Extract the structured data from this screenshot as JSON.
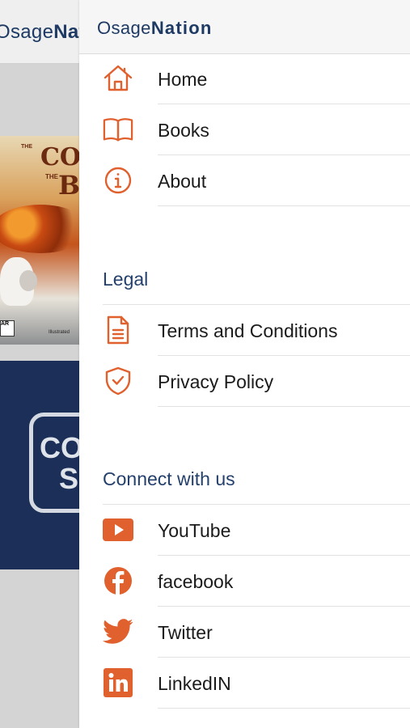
{
  "background": {
    "logo_light": "Osage",
    "logo_bold": "Nation",
    "cover_word_1": "THE",
    "cover_title_1": "CO",
    "cover_word_2": "THE",
    "cover_title_2": "B",
    "cover_badge": "AR",
    "cover_credit": "Illustrated",
    "banner_line_1": "CO",
    "banner_line_2": "S"
  },
  "drawer": {
    "logo_light": "Osage",
    "logo_bold": "Nation",
    "nav": [
      {
        "label": "Home",
        "icon": "home-icon"
      },
      {
        "label": "Books",
        "icon": "book-icon"
      },
      {
        "label": "About",
        "icon": "info-icon"
      }
    ],
    "legal": {
      "title": "Legal",
      "items": [
        {
          "label": "Terms and Conditions",
          "icon": "document-icon"
        },
        {
          "label": "Privacy Policy",
          "icon": "shield-check-icon"
        }
      ]
    },
    "connect": {
      "title": "Connect with us",
      "items": [
        {
          "label": "YouTube",
          "icon": "youtube-icon"
        },
        {
          "label": "facebook",
          "icon": "facebook-icon"
        },
        {
          "label": "Twitter",
          "icon": "twitter-icon"
        },
        {
          "label": "LinkedIN",
          "icon": "linkedin-icon"
        }
      ]
    }
  },
  "colors": {
    "accent": "#e0602e",
    "brand_navy": "#1e3a64",
    "banner": "#1c2f59"
  }
}
